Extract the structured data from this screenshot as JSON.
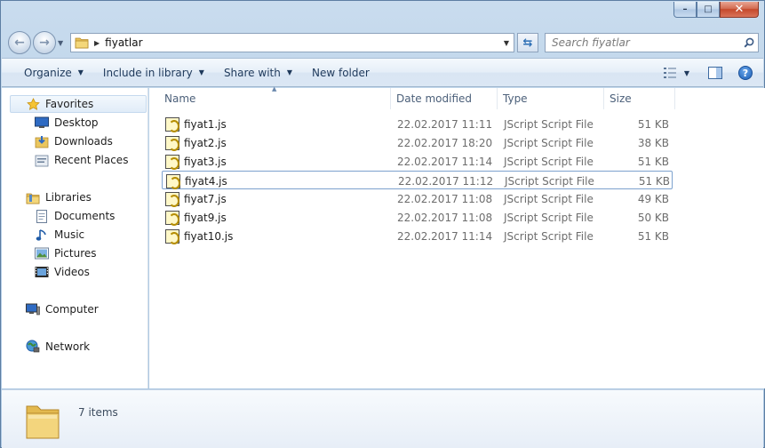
{
  "window": {
    "caption": {
      "minimize": "–",
      "maximize": "□",
      "close": "✕"
    }
  },
  "address": {
    "path": "fiyatlar",
    "search_placeholder": "Search fiyatlar"
  },
  "toolbar": {
    "organize": "Organize",
    "include_in_library": "Include in library",
    "share_with": "Share with",
    "new_folder": "New folder"
  },
  "nav": {
    "favorites": {
      "label": "Favorites",
      "items": [
        "Desktop",
        "Downloads",
        "Recent Places"
      ]
    },
    "libraries": {
      "label": "Libraries",
      "items": [
        "Documents",
        "Music",
        "Pictures",
        "Videos"
      ]
    },
    "computer": "Computer",
    "network": "Network"
  },
  "columns": {
    "name": "Name",
    "date": "Date modified",
    "type": "Type",
    "size": "Size"
  },
  "files": [
    {
      "name": "fiyat1.js",
      "date": "22.02.2017 11:11",
      "type": "JScript Script File",
      "size": "51 KB"
    },
    {
      "name": "fiyat2.js",
      "date": "22.02.2017 18:20",
      "type": "JScript Script File",
      "size": "38 KB"
    },
    {
      "name": "fiyat3.js",
      "date": "22.02.2017 11:14",
      "type": "JScript Script File",
      "size": "51 KB"
    },
    {
      "name": "fiyat4.js",
      "date": "22.02.2017 11:12",
      "type": "JScript Script File",
      "size": "51 KB"
    },
    {
      "name": "fiyat7.js",
      "date": "22.02.2017 11:08",
      "type": "JScript Script File",
      "size": "49 KB"
    },
    {
      "name": "fiyat9.js",
      "date": "22.02.2017 11:08",
      "type": "JScript Script File",
      "size": "50 KB"
    },
    {
      "name": "fiyat10.js",
      "date": "22.02.2017 11:14",
      "type": "JScript Script File",
      "size": "51 KB"
    }
  ],
  "status": {
    "item_count": "7 items"
  }
}
